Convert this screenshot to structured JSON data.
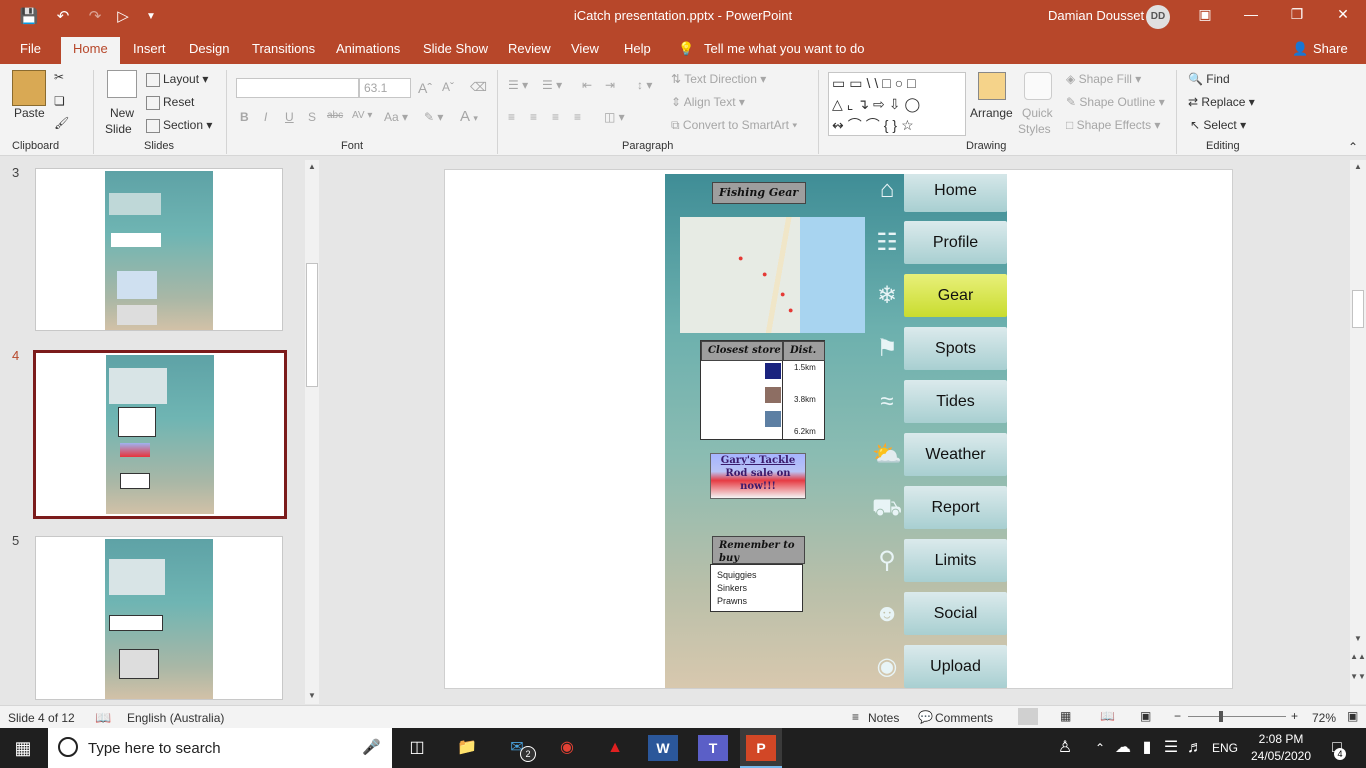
{
  "window": {
    "title": "iCatch presentation.pptx  -  PowerPoint",
    "user": "Damian Dousset",
    "initials": "DD"
  },
  "tabs": [
    "File",
    "Home",
    "Insert",
    "Design",
    "Transitions",
    "Animations",
    "Slide Show",
    "Review",
    "View",
    "Help"
  ],
  "tell_me": "Tell me what you want to do",
  "share": "Share",
  "ribbon": {
    "clipboard": {
      "label": "Clipboard",
      "paste": "Paste"
    },
    "slides": {
      "label": "Slides",
      "new_slide": "New",
      "new_slide2": "Slide",
      "layout": "Layout",
      "reset": "Reset",
      "section": "Section"
    },
    "font": {
      "label": "Font",
      "size": "63.1"
    },
    "paragraph": {
      "label": "Paragraph",
      "text_direction": "Text Direction",
      "align_text": "Align Text",
      "smartart": "Convert to SmartArt"
    },
    "drawing": {
      "label": "Drawing",
      "arrange": "Arrange",
      "quick": "Quick",
      "styles": "Styles",
      "shape_fill": "Shape Fill",
      "shape_outline": "Shape Outline",
      "shape_effects": "Shape Effects"
    },
    "editing": {
      "label": "Editing",
      "find": "Find",
      "replace": "Replace",
      "select": "Select"
    }
  },
  "thumbnails": [
    {
      "num": "3"
    },
    {
      "num": "4"
    },
    {
      "num": "5"
    }
  ],
  "slide": {
    "title": "Fishing Gear",
    "closest_store": "Closest store",
    "dist": "Dist.",
    "distances": [
      "1.5km",
      "3.8km",
      "6.2km"
    ],
    "promo_line1": "Gary's Tackle",
    "promo_line2": "Rod sale on",
    "promo_line3": "now!!!",
    "remember": "Remember to buy",
    "list": [
      "Squiggies",
      "Sinkers",
      "Prawns"
    ],
    "nav": [
      "Home",
      "Profile",
      "Gear",
      "Spots",
      "Tides",
      "Weather",
      "Report",
      "Limits",
      "Social",
      "Upload"
    ],
    "highlight": "Gear"
  },
  "status": {
    "slide": "Slide 4 of 12",
    "language": "English (Australia)",
    "notes": "Notes",
    "comments": "Comments",
    "zoom": "72%"
  },
  "taskbar": {
    "search": "Type here to search",
    "lang": "ENG",
    "time": "2:08 PM",
    "date": "24/05/2020",
    "notif": "4",
    "mail_badge": "2"
  },
  "colors": {
    "brand": "#b7472a",
    "highlight": "#d5e63a"
  }
}
